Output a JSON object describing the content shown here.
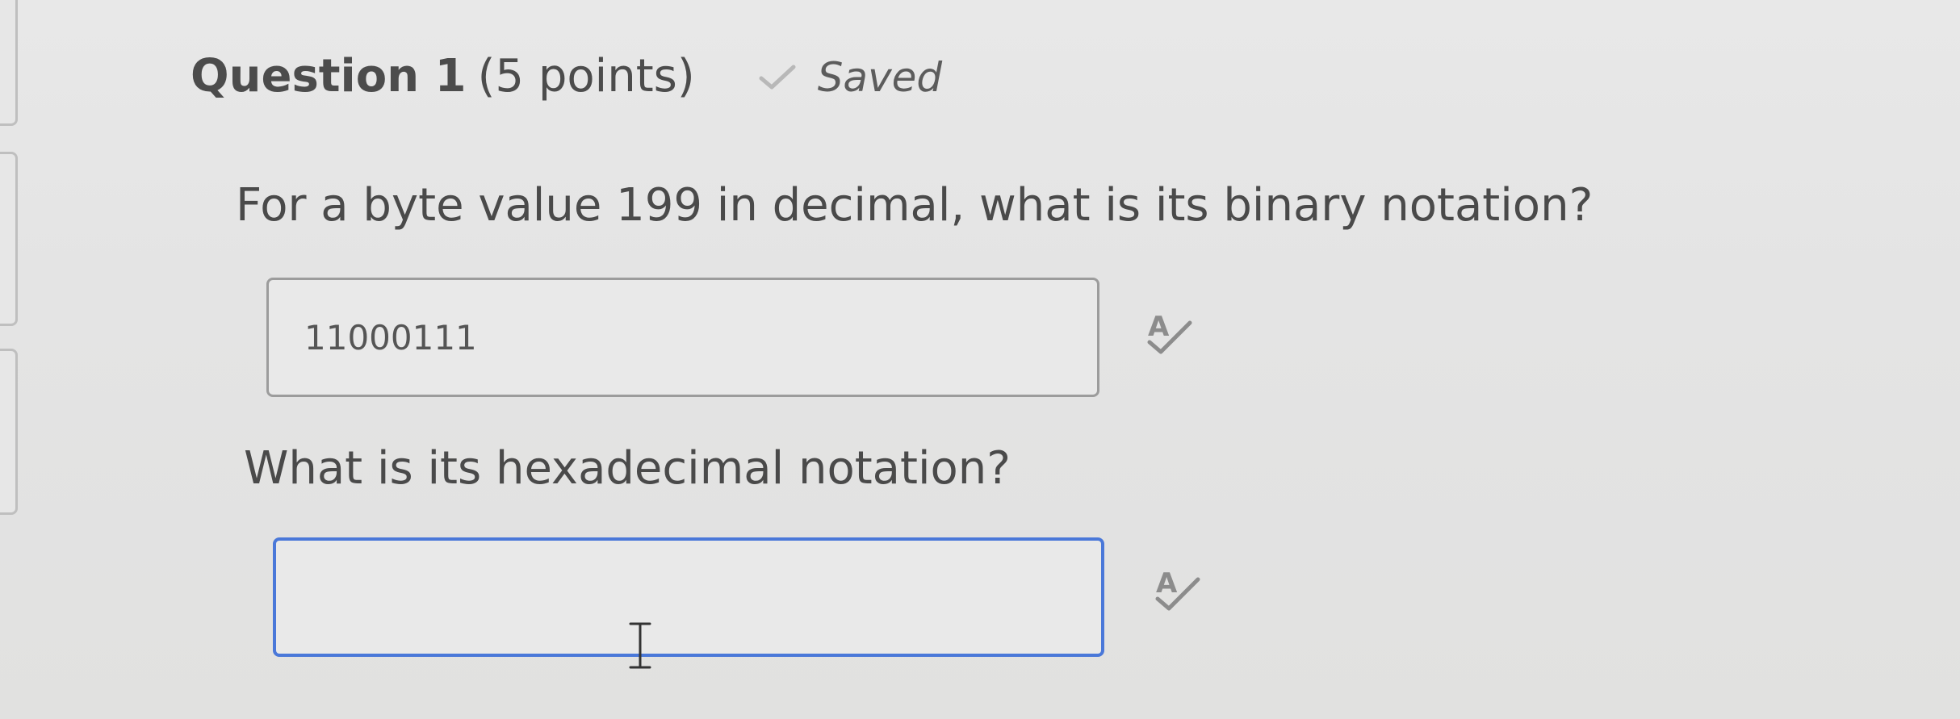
{
  "question": {
    "title": "Question 1",
    "points": "(5 points)",
    "status": "Saved",
    "status_icon": "check-icon",
    "status_color": "#b5b5b5"
  },
  "parts": [
    {
      "prompt": "For a byte value 199 in decimal, what is its binary notation?",
      "answer_value": "11000111",
      "focused": false,
      "tool_icon": "spell-check-icon"
    },
    {
      "prompt": "What is its hexadecimal notation?",
      "answer_value": "",
      "focused": true,
      "tool_icon": "spell-check-icon"
    }
  ],
  "colors": {
    "focus_border": "#4a78d9",
    "default_border": "#9c9c9c",
    "background": "#e6e6e6"
  }
}
